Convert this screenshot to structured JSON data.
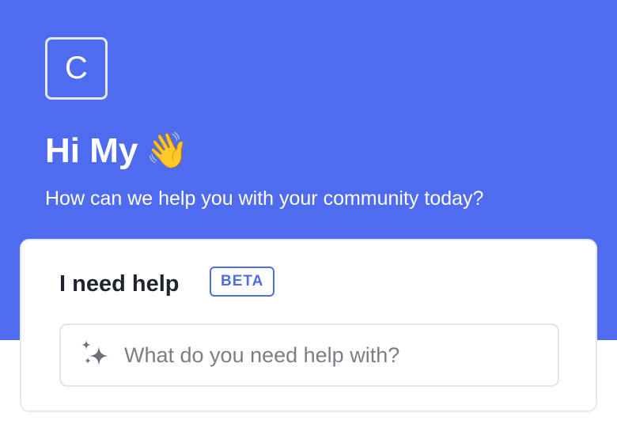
{
  "colors": {
    "accent": "#4f6bef",
    "hero_bg": "#4f6bef",
    "card_border": "#e6e8eb",
    "title_text": "#1f2430",
    "placeholder_text": "#7a7f87"
  },
  "header": {
    "logo_letter": "C",
    "greeting": "Hi My",
    "greeting_emoji": "👋",
    "subtitle": "How can we help you with your community today?"
  },
  "help_card": {
    "title": "I need help",
    "badge": "BETA",
    "input_icon": "sparkle-icon",
    "input_value": "",
    "input_placeholder": "What do you need help with?"
  }
}
